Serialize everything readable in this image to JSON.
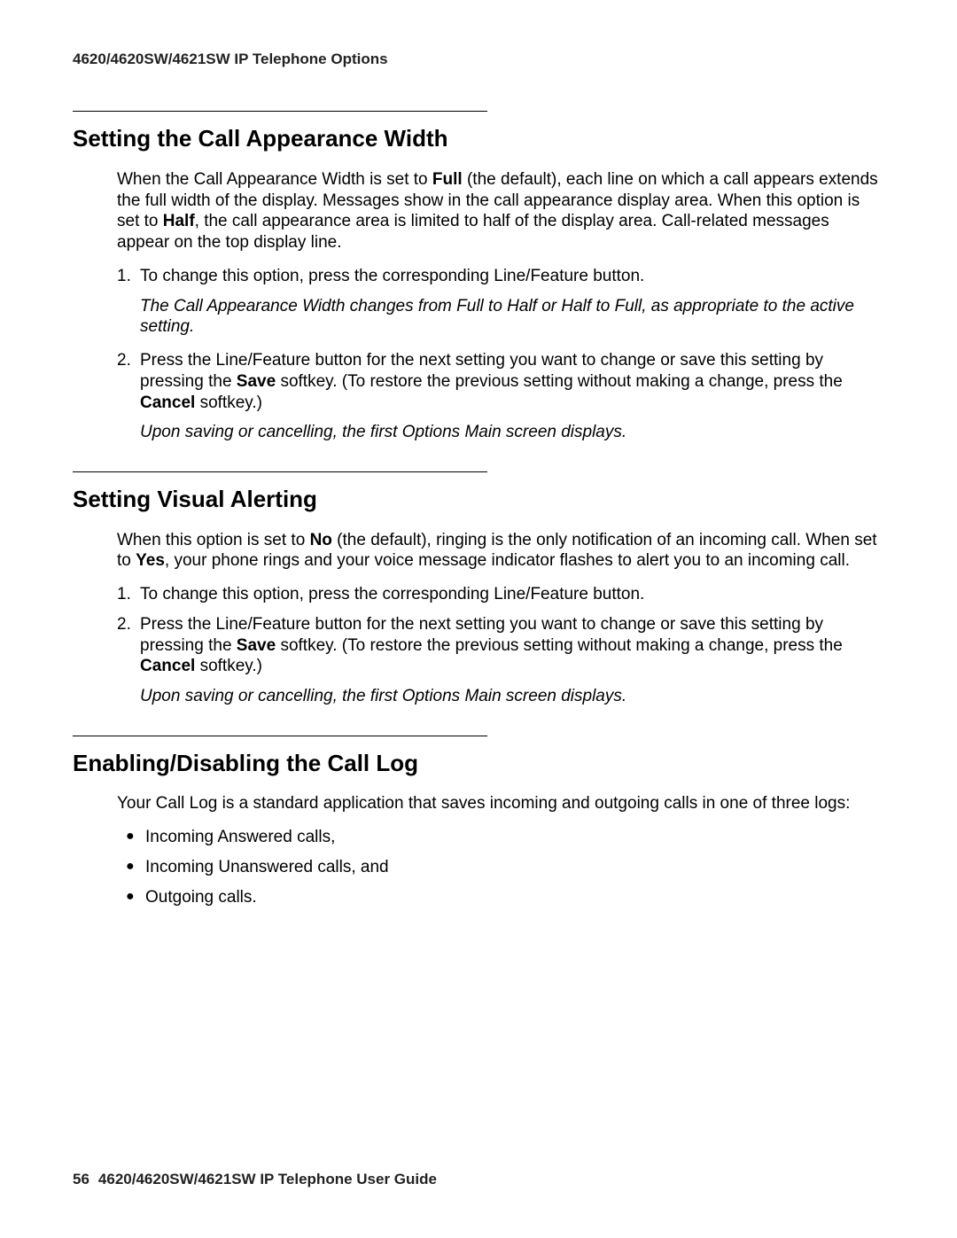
{
  "header": {
    "running": "4620/4620SW/4621SW IP Telephone Options"
  },
  "sections": [
    {
      "title": "Setting the Call Appearance Width",
      "intro": {
        "pre1": "When the Call Appearance Width is set to ",
        "b1": "Full",
        "mid1": " (the default), each line on which a call appears extends the full width of the display. Messages show in the call appearance display area. When this option is set to ",
        "b2": "Half",
        "post1": ", the call appearance area is limited to half of the display area. Call-related messages appear on the top display line."
      },
      "steps": [
        {
          "n": "1.",
          "text": "To change this option, press the corresponding Line/Feature button.",
          "result": "The Call Appearance Width changes from Full to Half or Half to Full, as appropriate to the active setting."
        },
        {
          "n": "2.",
          "pre": "Press the Line/Feature button for the next setting you want to change or save this setting by pressing the ",
          "b1": "Save",
          "mid": " softkey. (To restore the previous setting without making a change, press the ",
          "b2": "Cancel",
          "post": " softkey.)",
          "result": "Upon saving or cancelling, the first Options Main screen displays."
        }
      ]
    },
    {
      "title": "Setting Visual Alerting",
      "intro": {
        "pre1": "When this option is set to ",
        "b1": "No",
        "mid1": " (the default), ringing is the only notification of an incoming call. When set to ",
        "b2": "Yes",
        "post1": ", your phone rings and your voice message indicator flashes to alert you to an incoming call."
      },
      "steps": [
        {
          "n": "1.",
          "text": "To change this option, press the corresponding Line/Feature button."
        },
        {
          "n": "2.",
          "pre": "Press the Line/Feature button for the next setting you want to change or save this setting by pressing the ",
          "b1": "Save",
          "mid": " softkey. (To restore the previous setting without making a change, press the ",
          "b2": "Cancel",
          "post": " softkey.)",
          "result": "Upon saving or cancelling, the first Options Main screen displays."
        }
      ]
    },
    {
      "title": "Enabling/Disabling the Call Log",
      "intro_plain": "Your Call Log is a standard application that saves incoming and outgoing calls in one of three logs:",
      "bullets": [
        "Incoming Answered calls,",
        "Incoming Unanswered calls, and",
        "Outgoing calls."
      ]
    }
  ],
  "footer": {
    "page": "56",
    "title": "4620/4620SW/4621SW IP Telephone User Guide"
  }
}
